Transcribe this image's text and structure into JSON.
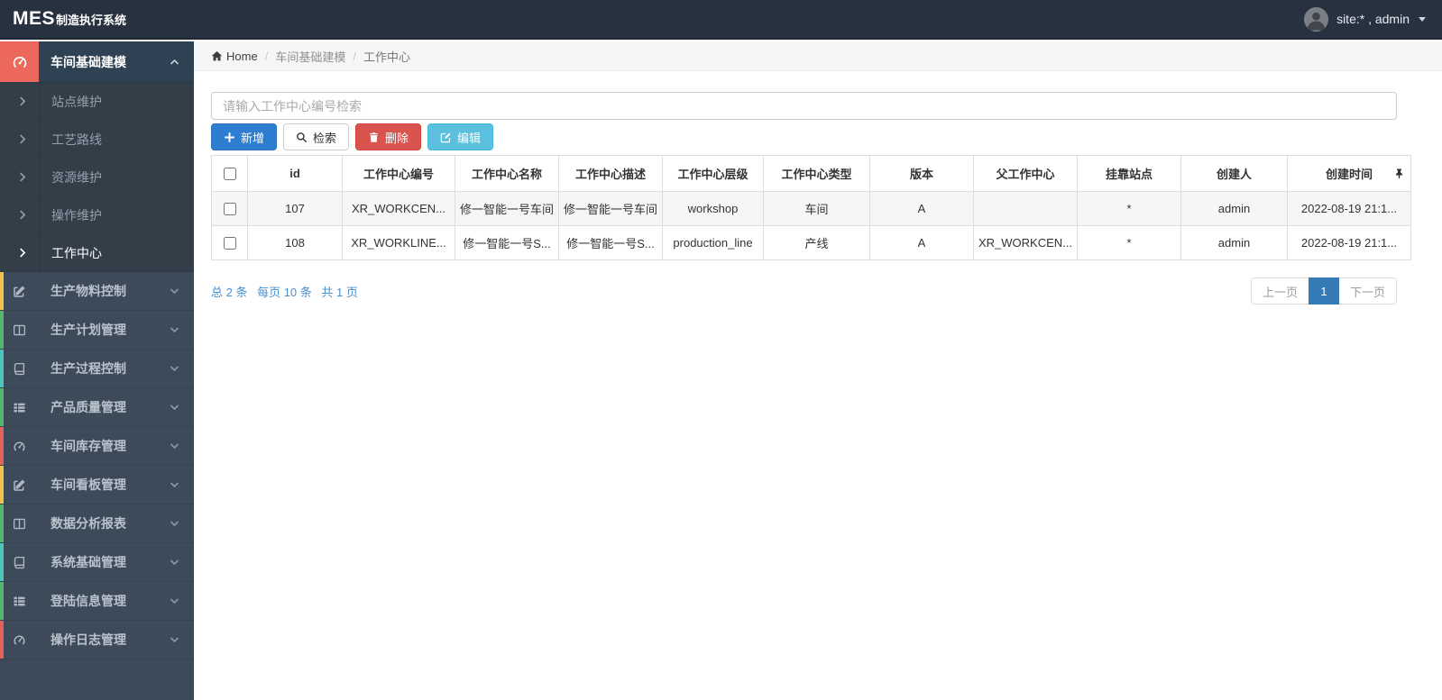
{
  "navbar": {
    "logo_bold": "MES",
    "logo_rest": "制造执行系统",
    "user_label": "site:* , admin"
  },
  "breadcrumb": {
    "home_label": "Home",
    "separator": "/",
    "crumbs": [
      "车间基础建模",
      "工作中心"
    ]
  },
  "sidebar": {
    "active_parent": {
      "label": "车间基础建模",
      "icon": "gauge",
      "icon_name": "gauge-icon",
      "icon_block_color": "#ec685c"
    },
    "submenu": [
      {
        "label": "站点维护",
        "active": false
      },
      {
        "label": "工艺路线",
        "active": false
      },
      {
        "label": "资源维护",
        "active": false
      },
      {
        "label": "操作维护",
        "active": false
      },
      {
        "label": "工作中心",
        "active": true
      }
    ],
    "items": [
      {
        "label": "生产物料控制",
        "icon": "edit",
        "icon_name": "edit-icon",
        "strip": "#eec54a"
      },
      {
        "label": "生产计划管理",
        "icon": "columns",
        "icon_name": "columns-icon",
        "strip": "#55b96d"
      },
      {
        "label": "生产过程控制",
        "icon": "book",
        "icon_name": "book-icon",
        "strip": "#4cc4ba"
      },
      {
        "label": "产品质量管理",
        "icon": "list",
        "icon_name": "list-icon",
        "strip": "#55b96d"
      },
      {
        "label": "车间库存管理",
        "icon": "gauge",
        "icon_name": "gauge-icon",
        "strip": "#e2615c"
      },
      {
        "label": "车间看板管理",
        "icon": "edit",
        "icon_name": "edit-icon",
        "strip": "#eec54a"
      },
      {
        "label": "数据分析报表",
        "icon": "columns",
        "icon_name": "columns-icon",
        "strip": "#55b96d"
      },
      {
        "label": "系统基础管理",
        "icon": "book",
        "icon_name": "book-icon",
        "strip": "#4cc4ba"
      },
      {
        "label": "登陆信息管理",
        "icon": "list",
        "icon_name": "list-icon",
        "strip": "#55b96d"
      },
      {
        "label": "操作日志管理",
        "icon": "gauge",
        "icon_name": "gauge-icon",
        "strip": "#e2615c"
      }
    ]
  },
  "toolbar": {
    "search_placeholder": "请输入工作中心编号检索",
    "add_label": "新增",
    "search_label": "检索",
    "delete_label": "删除",
    "edit_label": "编辑",
    "icons": {
      "add": "plus",
      "search": "magnifier",
      "delete": "trash",
      "edit": "edit-square"
    }
  },
  "table": {
    "columns": [
      "id",
      "工作中心编号",
      "工作中心名称",
      "工作中心描述",
      "工作中心层级",
      "工作中心类型",
      "版本",
      "父工作中心",
      "挂靠站点",
      "创建人",
      "创建时间"
    ],
    "rows": [
      {
        "id": "107",
        "code": "XR_WORKCEN...",
        "name": "修一智能一号车间",
        "desc": "修一智能一号车间",
        "level": "workshop",
        "type": "车间",
        "version": "A",
        "parent": "",
        "station": "*",
        "creator": "admin",
        "created": "2022-08-19 21:1..."
      },
      {
        "id": "108",
        "code": "XR_WORKLINE...",
        "name": "修一智能一号S...",
        "desc": "修一智能一号S...",
        "level": "production_line",
        "type": "产线",
        "version": "A",
        "parent": "XR_WORKCEN...",
        "station": "*",
        "creator": "admin",
        "created": "2022-08-19 21:1..."
      }
    ]
  },
  "pagination": {
    "summary": [
      "总 2 条",
      "每页 10 条",
      "共 1 页"
    ],
    "prev": "上一页",
    "current": "1",
    "next": "下一页"
  },
  "colors": {
    "navbar_bg": "#273140",
    "sidebar_bg": "#3d4a59",
    "active_parent_bg": "#2e4254",
    "active_icon_block": "#ec685c",
    "primary_button": "#2e7dd1",
    "danger_button": "#d9534f",
    "info_button": "#5bc0de",
    "active_page": "#337ab7",
    "pager_info_text": "#4a90cd"
  }
}
